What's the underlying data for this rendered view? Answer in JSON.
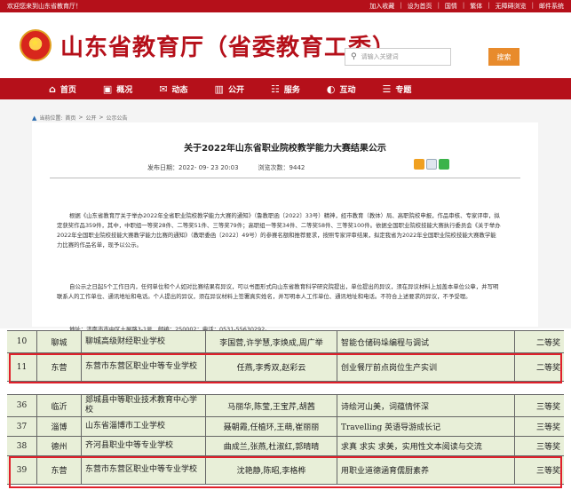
{
  "topbar": {
    "welcome": "欢迎您来到山东省教育厅！",
    "links": [
      "加入收藏",
      "设为首页",
      "国情",
      "繁体",
      "无障碍浏览",
      "邮件系统"
    ]
  },
  "header": {
    "site_title": "山东省教育厅（省委教育工委）",
    "search_placeholder": "请输入关键词",
    "search_button": "搜索"
  },
  "nav": {
    "items": [
      {
        "icon": "home-icon",
        "glyph": "⌂",
        "label": "首页"
      },
      {
        "icon": "overview-icon",
        "glyph": "▣",
        "label": "概况"
      },
      {
        "icon": "news-icon",
        "glyph": "✉",
        "label": "动态"
      },
      {
        "icon": "public-icon",
        "glyph": "▥",
        "label": "公开"
      },
      {
        "icon": "service-icon",
        "glyph": "☷",
        "label": "服务"
      },
      {
        "icon": "interact-icon",
        "glyph": "◐",
        "label": "互动"
      },
      {
        "icon": "topic-icon",
        "glyph": "☰",
        "label": "专题"
      }
    ]
  },
  "breadcrumb": {
    "prefix": "当前位置:",
    "items": [
      "首页",
      "公开",
      "公示公告"
    ]
  },
  "article": {
    "title": "关于2022年山东省职业院校教学能力大赛结果公示",
    "publish_label": "发布日期：",
    "publish_date": "2022- 09- 23 20:03",
    "views_label": "浏览次数：",
    "views": "9442",
    "paragraph1": "根据《山东省教育厅关于举办2022年全省职业院校教学能力大赛的通知》（鲁教职函〔2022〕33号）精神，经市教育（教体）局、高职院校申报，作品审核、专家评审，拟定获奖作品359件，其中，中职组一等奖28件、二等奖51件、三等奖79件；高职组一等奖34件、二等奖58件、三等奖100件。依据全国职业院校技能大赛执行委员会《关于举办2022年全国职业院校技能大赛教学能力比赛的通知》（教职委函〔2022〕49号）的参赛名额和推荐要求，按照专家评审结果，拟定我省为2022年全国职业院校技能大赛教学能力比赛的作品名单，现予以公示。",
    "paragraph2": "自公示之日起5个工作日内，任何单位和个人如对比赛结果有异议，可以书面形式向山东省教育科学研究院提出，单位提出的异议，须在异议材料上加盖本单位公章，并写明联系人的工作单位、通讯地址和电话。个人提出的异议，须在异议材料上签署真实姓名，并写明本人工作单位、通讯地址和电话。不符合上述要求的异议，不予受理。",
    "address": "地址：济南市市中区土屋路3-1号，邮编：250002；电话：0531-55630292。"
  },
  "table_block1": [
    {
      "no": "10",
      "city": "聊城",
      "school": "聊城高级财经职业学校",
      "team": "李国营,许学慧,李焕成,周广举",
      "title": "智能仓储码垛编程与调试",
      "award": "二等奖"
    },
    {
      "no": "11",
      "city": "东营",
      "school": "东营市东营区职业中等专业学校",
      "team": "任燕,李秀双,赵彩云",
      "title": "创业餐厅前点岗位生产实训",
      "award": "二等奖"
    }
  ],
  "table_block2": [
    {
      "no": "36",
      "city": "临沂",
      "school": "郯城县中等职业技术教育中心学校",
      "team": "马丽华,陈莹,王宝芹,胡茜",
      "title": "诗绘河山美，词蕴情怀深",
      "award": "三等奖"
    },
    {
      "no": "37",
      "city": "淄博",
      "school": "山东省淄博市工业学校",
      "team": "聂朝霞,任植环,王萌,崔丽丽",
      "title": "Travelling 英语导游成长记",
      "award": "三等奖"
    },
    {
      "no": "38",
      "city": "德州",
      "school": "齐河县职业中等专业学校",
      "team": "曲成兰,张燕,杜淑红,郭晴晴",
      "title": "求真 求实 求美，实用性文本阅读与交流",
      "award": "三等奖"
    },
    {
      "no": "39",
      "city": "东营",
      "school": "东营市东营区职业中等专业学校",
      "team": "沈艳静,陈昭,李格桦",
      "title": "用职业道德涵育儒厨素养",
      "award": "三等奖"
    }
  ],
  "colors": {
    "brand_red": "#b5101a",
    "highlight_red": "#e0202a",
    "table_bg": "#e8efd8"
  }
}
